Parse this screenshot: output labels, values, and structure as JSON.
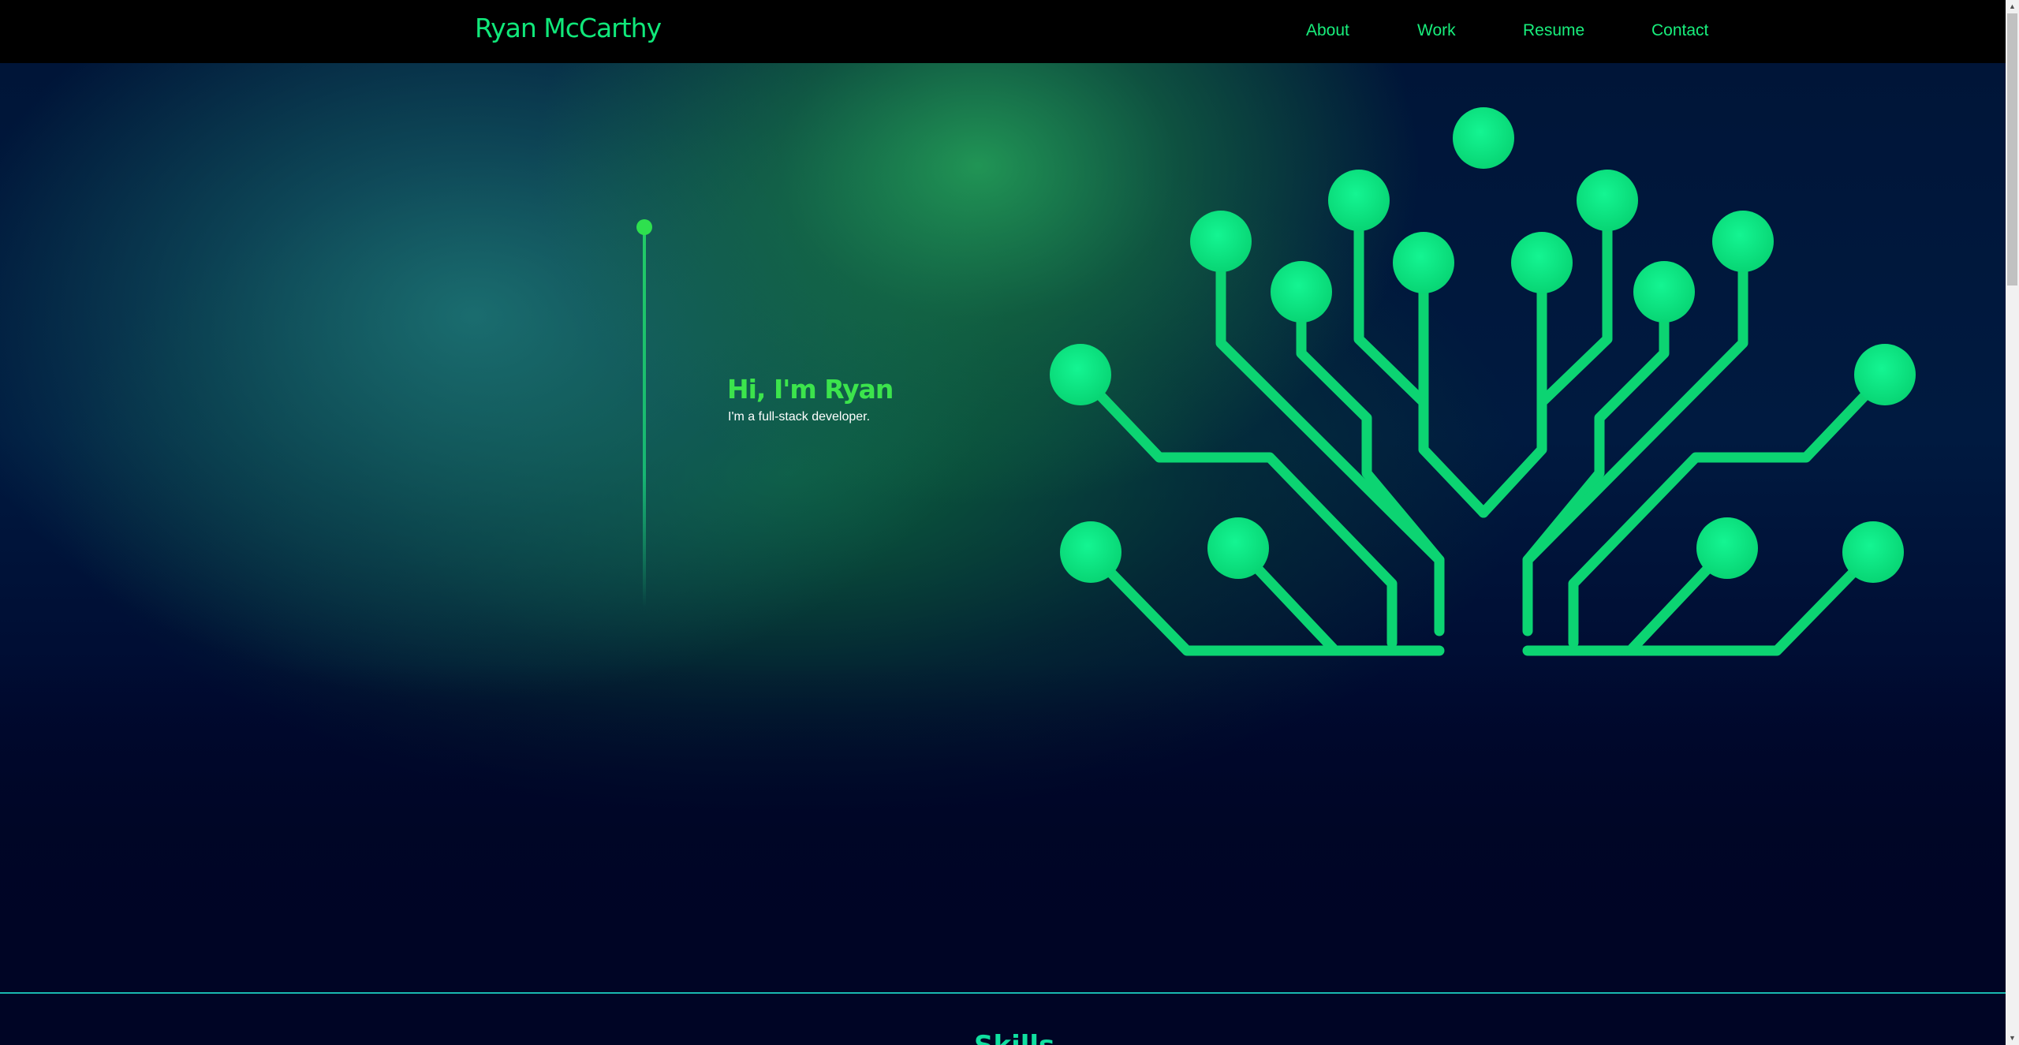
{
  "header": {
    "brand": "Ryan McCarthy",
    "nav": [
      {
        "label": "About"
      },
      {
        "label": "Work"
      },
      {
        "label": "Resume"
      },
      {
        "label": "Contact"
      }
    ]
  },
  "hero": {
    "title": "Hi, I'm Ryan",
    "subtitle": "I'm a full-stack developer.",
    "illustration": "circuit-tree-icon"
  },
  "skills": {
    "title": "Skills"
  },
  "colors": {
    "accent": "#10e87a",
    "background": "#000525",
    "divider": "#19b8b0"
  }
}
